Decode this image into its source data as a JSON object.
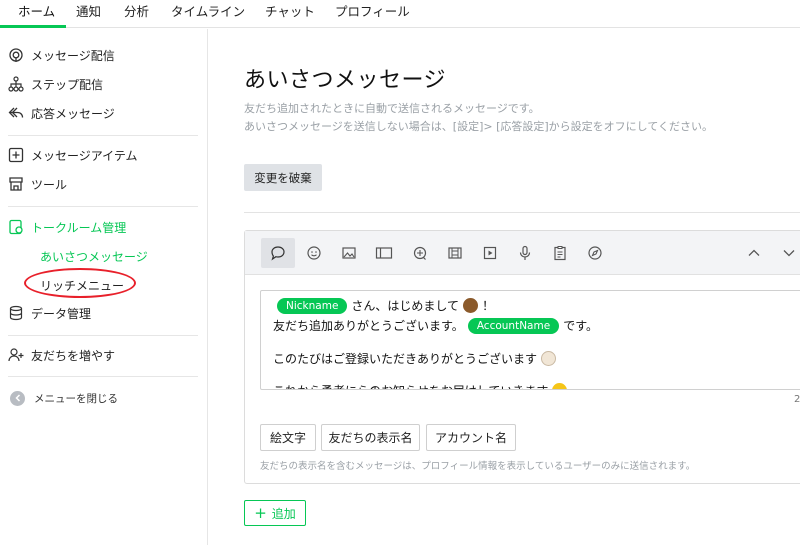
{
  "nav": {
    "tabs": [
      {
        "label": "ホーム",
        "active": true
      },
      {
        "label": "通知"
      },
      {
        "label": "分析"
      },
      {
        "label": "タイムライン"
      },
      {
        "label": "チャット"
      },
      {
        "label": "プロフィール"
      }
    ]
  },
  "sidebar": {
    "items": [
      {
        "label": "メッセージ配信",
        "icon": "broadcast-icon"
      },
      {
        "label": "ステップ配信",
        "icon": "hierarchy-icon"
      },
      {
        "label": "応答メッセージ",
        "icon": "reply-icon"
      },
      {
        "label": "メッセージアイテム",
        "icon": "plus-square-icon"
      },
      {
        "label": "ツール",
        "icon": "shop-icon"
      },
      {
        "label": "トークルーム管理",
        "icon": "chat-settings-icon",
        "active": true
      },
      {
        "label": "データ管理",
        "icon": "database-icon"
      },
      {
        "label": "友だちを増やす",
        "icon": "add-user-icon"
      }
    ],
    "subitems": [
      {
        "label": "あいさつメッセージ",
        "active": true
      },
      {
        "label": "リッチメニュー"
      }
    ],
    "close_menu": "メニューを閉じる"
  },
  "main": {
    "title": "あいさつメッセージ",
    "description_1": "友だち追加されたときに自動で送信されるメッセージです。",
    "description_2": "あいさつメッセージを送信しない場合は、[設定]> [応答設定]から設定をオフにしてください。",
    "discard_button": "変更を破棄",
    "editor": {
      "line1": {
        "pill": "Nickname",
        "text": "さん、はじめまして",
        "after": "！"
      },
      "line2": {
        "text": "友だち追加ありがとうございます。",
        "pill": "AccountName",
        "after": "です。"
      },
      "line3": {
        "text": "このたびはご登録いただきありがとうございます"
      },
      "line4": {
        "text": "これから勇者にらのお知らせをお届けしていきます"
      },
      "counter": "2"
    },
    "insert_buttons": [
      "絵文字",
      "友だちの表示名",
      "アカウント名"
    ],
    "note": "友だちの表示名を含むメッセージは、プロフィール情報を表示しているユーザーのみに送信されます。",
    "add_button": "追加"
  },
  "colors": {
    "accent": "#06c755",
    "highlight_oval": "#e8202a"
  }
}
